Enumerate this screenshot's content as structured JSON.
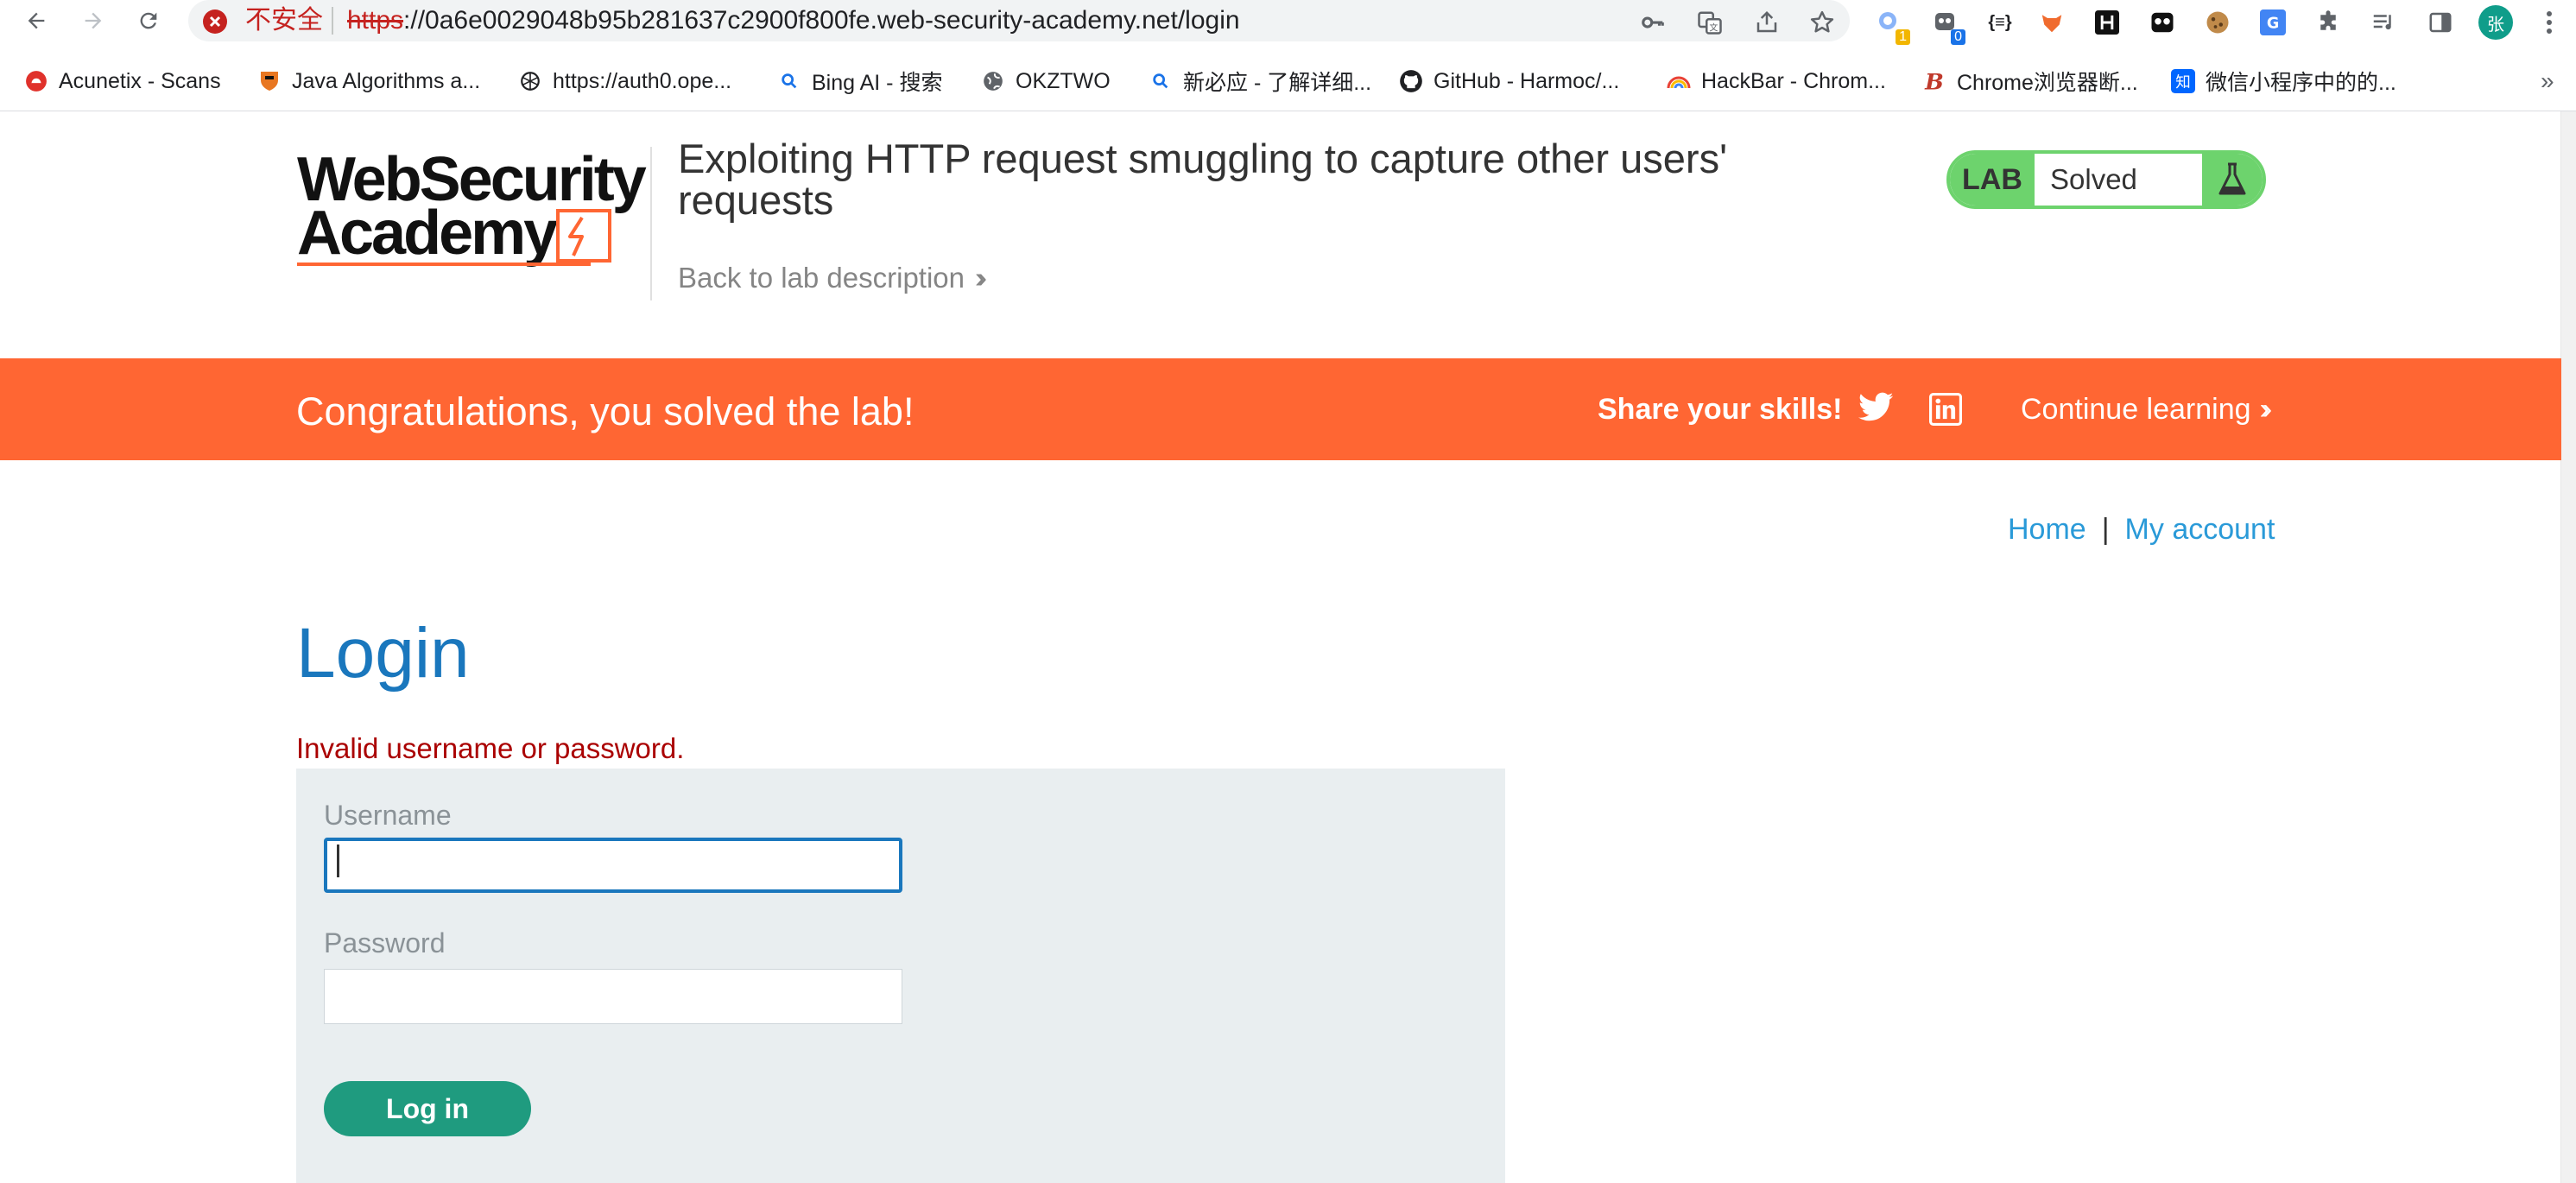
{
  "browser": {
    "security_label": "不安全",
    "url_scheme": "https",
    "url_rest": "://0a6e0029048b95b281637c2900f800fe.web-security-academy.net/login",
    "extension_badges": [
      "1",
      "0"
    ],
    "profile_initial": "张",
    "bookmarks": [
      {
        "label": "Acunetix - Scans",
        "icon": "acunetix-icon"
      },
      {
        "label": "Java Algorithms a...",
        "icon": "princeton-shield-icon"
      },
      {
        "label": "https://auth0.ope...",
        "icon": "openai-icon"
      },
      {
        "label": "Bing AI - 搜索",
        "icon": "search-icon"
      },
      {
        "label": "OKZTWO",
        "icon": "globe-icon"
      },
      {
        "label": "新必应 - 了解详细...",
        "icon": "search-icon"
      },
      {
        "label": "GitHub - Harmoc/...",
        "icon": "github-icon"
      },
      {
        "label": "HackBar - Chrom...",
        "icon": "rainbow-icon"
      },
      {
        "label": "Chrome浏览器断...",
        "icon": "b-logo-icon"
      },
      {
        "label": "微信小程序中的的...",
        "icon": "zhihu-icon"
      }
    ],
    "more_bookmarks": "»"
  },
  "header": {
    "logo_line1": "WebSecurity",
    "logo_line2": "Academy",
    "lab_title": "Exploiting HTTP request smuggling to capture other users' requests",
    "back_link": "Back to lab description",
    "lab_label": "LAB",
    "lab_status": "Solved"
  },
  "banner": {
    "message": "Congratulations, you solved the lab!",
    "share_label": "Share your skills!",
    "continue_label": "Continue learning",
    "color": "#ff6633"
  },
  "nav": {
    "home": "Home",
    "separator": "|",
    "my_account": "My account"
  },
  "login": {
    "heading": "Login",
    "error": "Invalid username or password.",
    "username_label": "Username",
    "username_value": "",
    "password_label": "Password",
    "password_value": "",
    "submit_label": "Log in"
  },
  "colors": {
    "accent_blue": "#1a77bd",
    "link_blue": "#2a9ad8",
    "solved_green": "#6dd36d",
    "button_green": "#1f9b7f",
    "error_red": "#aa0000"
  }
}
